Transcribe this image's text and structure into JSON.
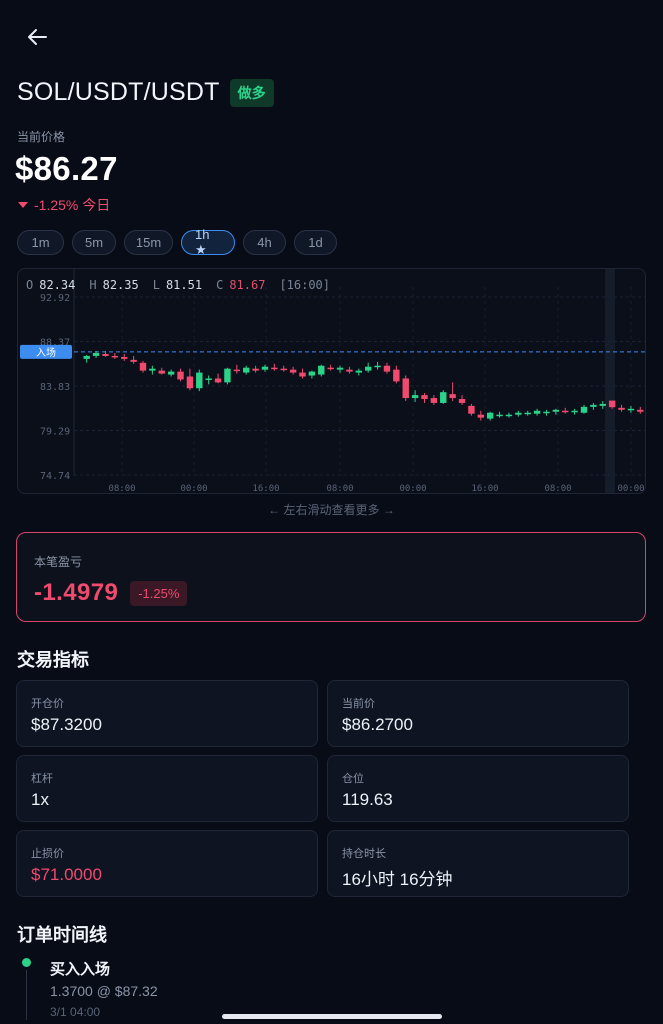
{
  "header": {
    "pair": "SOL/USDT/USDT",
    "side_badge": "做多",
    "current_price_label": "当前价格",
    "price": "$86.27",
    "change": "-1.25% 今日"
  },
  "timeframes": [
    {
      "label": "1m",
      "active": false
    },
    {
      "label": "5m",
      "active": false
    },
    {
      "label": "15m",
      "active": false
    },
    {
      "label": "1h ★",
      "active": true
    },
    {
      "label": "4h",
      "active": false
    },
    {
      "label": "1d",
      "active": false
    }
  ],
  "chart": {
    "ohlc": {
      "o_label": "O",
      "o": "82.34",
      "h_label": "H",
      "h": "82.35",
      "l_label": "L",
      "l": "81.51",
      "c_label": "C",
      "c": "81.67",
      "time": "[16:00]"
    },
    "entry_label": "入场",
    "scroll_hint": "← 左右滑动查看更多 →"
  },
  "chart_data": {
    "type": "candlestick",
    "y_ticks": [
      "92.92",
      "88.37",
      "83.83",
      "79.29",
      "74.74"
    ],
    "ylim": [
      74.74,
      92.92
    ],
    "x_ticks": [
      "08:00",
      "00:00",
      "16:00",
      "08:00",
      "00:00",
      "16:00",
      "08:00",
      "00:00"
    ],
    "entry_price": 87.32,
    "candles": [
      [
        86.6,
        87.0,
        86.2,
        86.9
      ],
      [
        86.9,
        87.4,
        86.7,
        87.2
      ],
      [
        87.1,
        87.4,
        86.8,
        86.9
      ],
      [
        86.9,
        87.2,
        86.6,
        86.8
      ],
      [
        86.8,
        87.1,
        86.4,
        86.6
      ],
      [
        86.5,
        86.9,
        86.1,
        86.3
      ],
      [
        86.2,
        86.4,
        85.2,
        85.4
      ],
      [
        85.4,
        85.9,
        85.0,
        85.6
      ],
      [
        85.4,
        85.7,
        85.0,
        85.1
      ],
      [
        85.0,
        85.5,
        84.8,
        85.3
      ],
      [
        85.3,
        85.6,
        84.3,
        84.5
      ],
      [
        84.8,
        85.6,
        83.4,
        83.6
      ],
      [
        83.6,
        85.5,
        83.3,
        85.2
      ],
      [
        84.5,
        84.9,
        84.0,
        84.6
      ],
      [
        84.6,
        85.1,
        84.1,
        84.2
      ],
      [
        84.2,
        85.7,
        84.0,
        85.6
      ],
      [
        85.5,
        86.0,
        85.1,
        85.4
      ],
      [
        85.2,
        85.9,
        85.0,
        85.7
      ],
      [
        85.6,
        85.9,
        85.2,
        85.4
      ],
      [
        85.5,
        86.0,
        85.3,
        85.8
      ],
      [
        85.7,
        86.1,
        85.4,
        85.6
      ],
      [
        85.6,
        85.9,
        85.3,
        85.5
      ],
      [
        85.5,
        85.8,
        85.0,
        85.2
      ],
      [
        85.2,
        85.6,
        84.6,
        84.8
      ],
      [
        84.9,
        85.4,
        84.6,
        85.3
      ],
      [
        85.0,
        86.0,
        84.8,
        85.9
      ],
      [
        85.7,
        86.0,
        85.4,
        85.6
      ],
      [
        85.5,
        85.9,
        85.2,
        85.7
      ],
      [
        85.5,
        85.8,
        85.1,
        85.3
      ],
      [
        85.2,
        85.6,
        84.9,
        85.4
      ],
      [
        85.4,
        86.2,
        85.2,
        85.8
      ],
      [
        85.8,
        86.3,
        85.5,
        85.9
      ],
      [
        85.9,
        86.2,
        85.1,
        85.3
      ],
      [
        85.5,
        85.9,
        84.1,
        84.3
      ],
      [
        84.6,
        84.9,
        82.3,
        82.6
      ],
      [
        82.6,
        83.4,
        82.2,
        82.9
      ],
      [
        82.9,
        83.1,
        82.1,
        82.5
      ],
      [
        82.6,
        82.9,
        81.9,
        82.1
      ],
      [
        82.1,
        83.4,
        82.0,
        83.2
      ],
      [
        83.0,
        84.2,
        82.3,
        82.6
      ],
      [
        82.5,
        82.9,
        81.9,
        82.1
      ],
      [
        81.8,
        82.0,
        80.8,
        81.0
      ],
      [
        80.9,
        81.3,
        80.3,
        80.6
      ],
      [
        80.5,
        81.2,
        80.3,
        81.1
      ],
      [
        80.9,
        81.2,
        80.6,
        80.9
      ],
      [
        80.8,
        81.1,
        80.6,
        80.9
      ],
      [
        80.9,
        81.3,
        80.7,
        81.1
      ],
      [
        81.0,
        81.3,
        80.8,
        81.1
      ],
      [
        81.0,
        81.5,
        80.8,
        81.3
      ],
      [
        81.1,
        81.4,
        80.8,
        81.2
      ],
      [
        81.2,
        81.5,
        80.9,
        81.4
      ],
      [
        81.3,
        81.6,
        81.0,
        81.2
      ],
      [
        81.2,
        81.5,
        80.9,
        81.3
      ],
      [
        81.1,
        81.9,
        81.0,
        81.7
      ],
      [
        81.7,
        82.1,
        81.4,
        81.9
      ],
      [
        81.8,
        82.3,
        81.5,
        82.0
      ],
      [
        82.34,
        82.35,
        81.51,
        81.67
      ],
      [
        81.6,
        81.9,
        81.2,
        81.4
      ],
      [
        81.4,
        81.8,
        81.1,
        81.5
      ],
      [
        81.4,
        81.7,
        81.0,
        81.2
      ]
    ]
  },
  "pnl": {
    "label": "本笔盈亏",
    "value": "-1.4979",
    "pct": "-1.25%"
  },
  "metrics_title": "交易指标",
  "metrics": [
    {
      "label": "开仓价",
      "value": "$87.3200",
      "red": false
    },
    {
      "label": "当前价",
      "value": "$86.2700",
      "red": false
    },
    {
      "label": "杠杆",
      "value": "1x",
      "red": false
    },
    {
      "label": "仓位",
      "value": "119.63",
      "red": false
    },
    {
      "label": "止损价",
      "value": "$71.0000",
      "red": true
    },
    {
      "label": "持仓时长",
      "value": "16小时 16分钟",
      "red": false
    }
  ],
  "timeline_title": "订单时间线",
  "timeline": [
    {
      "title": "买入入场",
      "sub": "1.3700 @ $87.32",
      "time": "3/1 04:00"
    }
  ],
  "colors": {
    "up": "#2bd38a",
    "down": "#f04a6e",
    "accent": "#3d8cf0",
    "bg": "#080c17"
  }
}
